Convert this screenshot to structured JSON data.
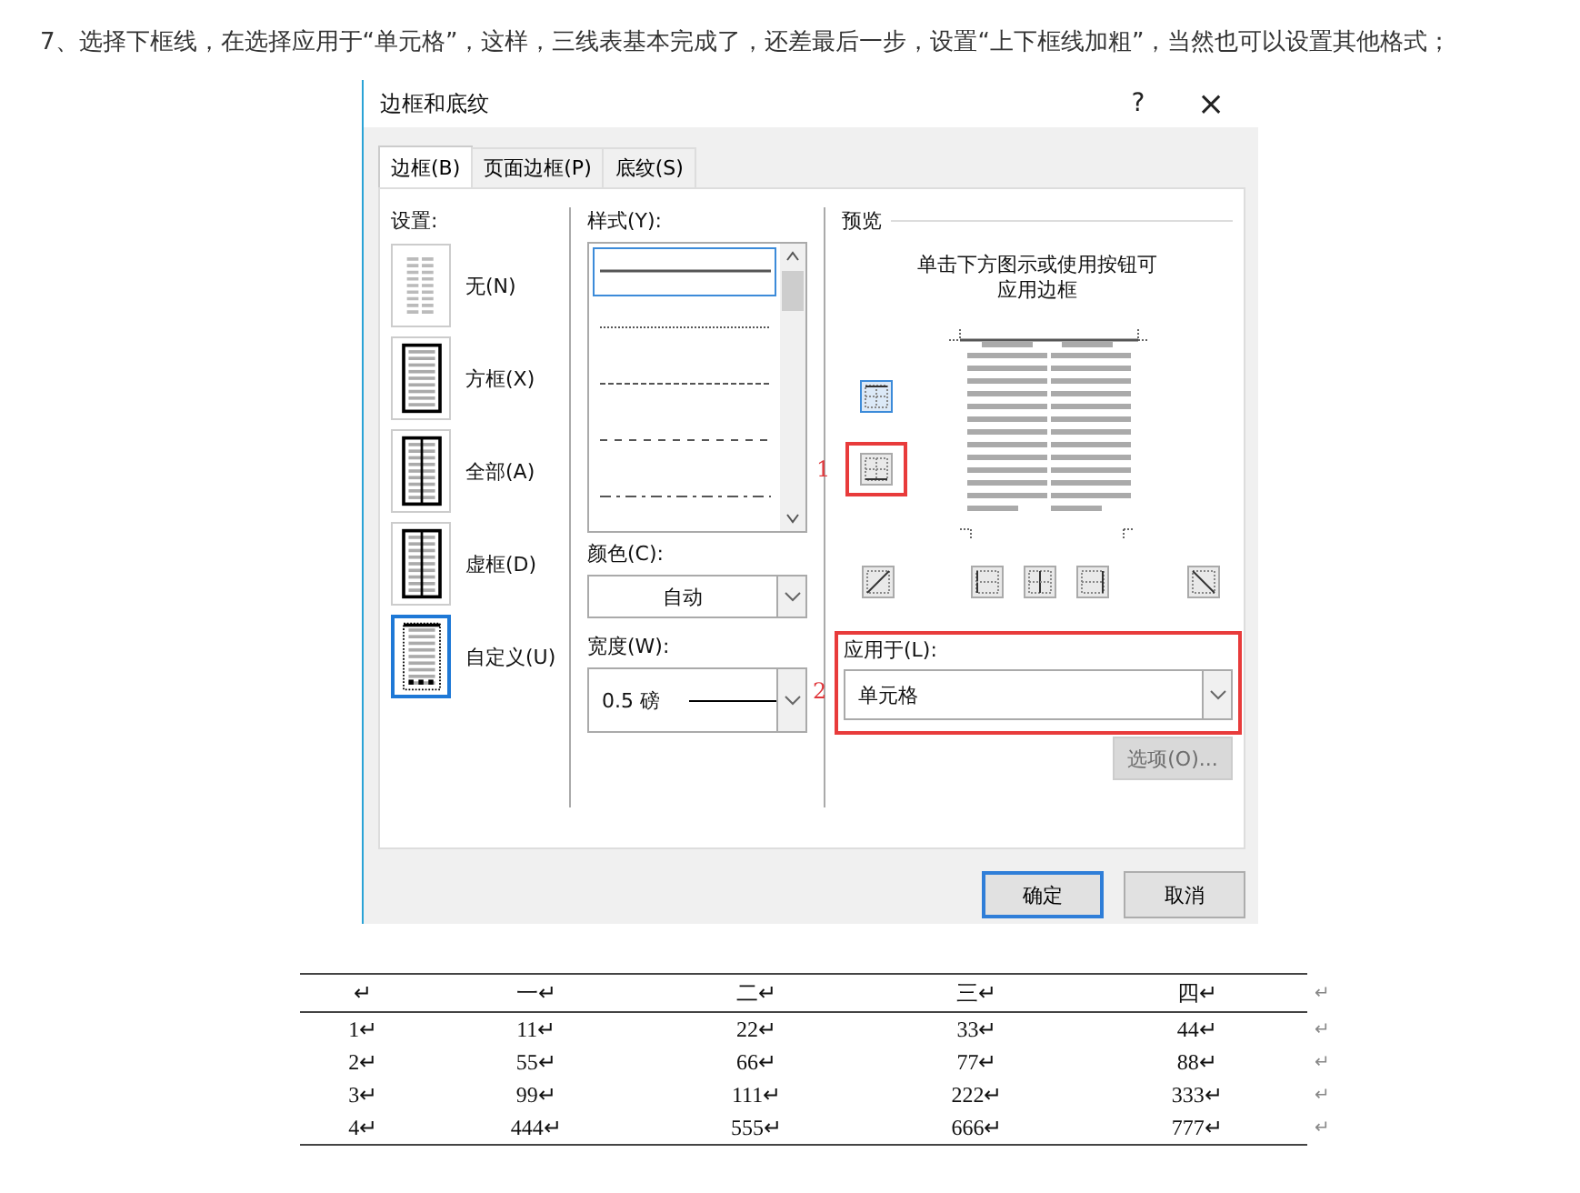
{
  "caption": "7、选择下框线，在选择应用于“单元格”，这样，三线表基本完成了，还差最后一步，设置“上下框线加粗”，当然也可以设置其他格式；",
  "dialog": {
    "title": "边框和底纹",
    "help": "?",
    "close": "×",
    "tabs": [
      {
        "label": "边框(B)",
        "selected": true
      },
      {
        "label": "页面边框(P)",
        "selected": false
      },
      {
        "label": "底纹(S)",
        "selected": false
      }
    ],
    "settings": {
      "label": "设置:",
      "items": [
        {
          "label": "无(N)",
          "kind": "none",
          "selected": false
        },
        {
          "label": "方框(X)",
          "kind": "box",
          "selected": false
        },
        {
          "label": "全部(A)",
          "kind": "all",
          "selected": false
        },
        {
          "label": "虚框(D)",
          "kind": "grid",
          "selected": false
        },
        {
          "label": "自定义(U)",
          "kind": "custom",
          "selected": true
        }
      ]
    },
    "style": {
      "label": "样式(Y):",
      "lines": [
        {
          "kind": "solid",
          "selected": true
        },
        {
          "kind": "dotted",
          "selected": false
        },
        {
          "kind": "dense-dash",
          "selected": false
        },
        {
          "kind": "dash",
          "selected": false
        },
        {
          "kind": "dash-dot",
          "selected": false
        }
      ]
    },
    "color": {
      "label": "颜色(C):",
      "value": "自动"
    },
    "width": {
      "label": "宽度(W):",
      "value": "0.5 磅"
    },
    "preview": {
      "label": "预览",
      "hint": "单击下方图示或使用按钮可应用边框",
      "side_buttons": [
        {
          "kind": "top",
          "pressed": true
        },
        {
          "kind": "bottom",
          "pressed": false,
          "annotation": "1"
        }
      ],
      "bottom_buttons": [
        {
          "kind": "diag-up",
          "pressed": false
        },
        {
          "kind": "left",
          "pressed": false
        },
        {
          "kind": "inner-v",
          "pressed": false
        },
        {
          "kind": "right",
          "pressed": false
        },
        {
          "kind": "diag-down",
          "pressed": false
        }
      ]
    },
    "apply_to": {
      "label": "应用于(L):",
      "value": "单元格",
      "annotation": "2"
    },
    "options_button": {
      "label": "选项(O)...",
      "disabled": true
    },
    "buttons": [
      {
        "label": "确定",
        "default": true
      },
      {
        "label": "取消",
        "default": false
      }
    ]
  },
  "table": {
    "columns": [
      "↵",
      "一↵",
      "二↵",
      "三↵",
      "四↵",
      "↵"
    ],
    "rows": [
      [
        "1↵",
        "11↵",
        "22↵",
        "33↵",
        "44↵",
        "↵"
      ],
      [
        "2↵",
        "55↵",
        "66↵",
        "77↵",
        "88↵",
        "↵"
      ],
      [
        "3↵",
        "99↵",
        "111↵",
        "222↵",
        "333↵",
        "↵"
      ],
      [
        "4↵",
        "444↵",
        "555↵",
        "666↵",
        "777↵",
        "↵"
      ]
    ]
  }
}
